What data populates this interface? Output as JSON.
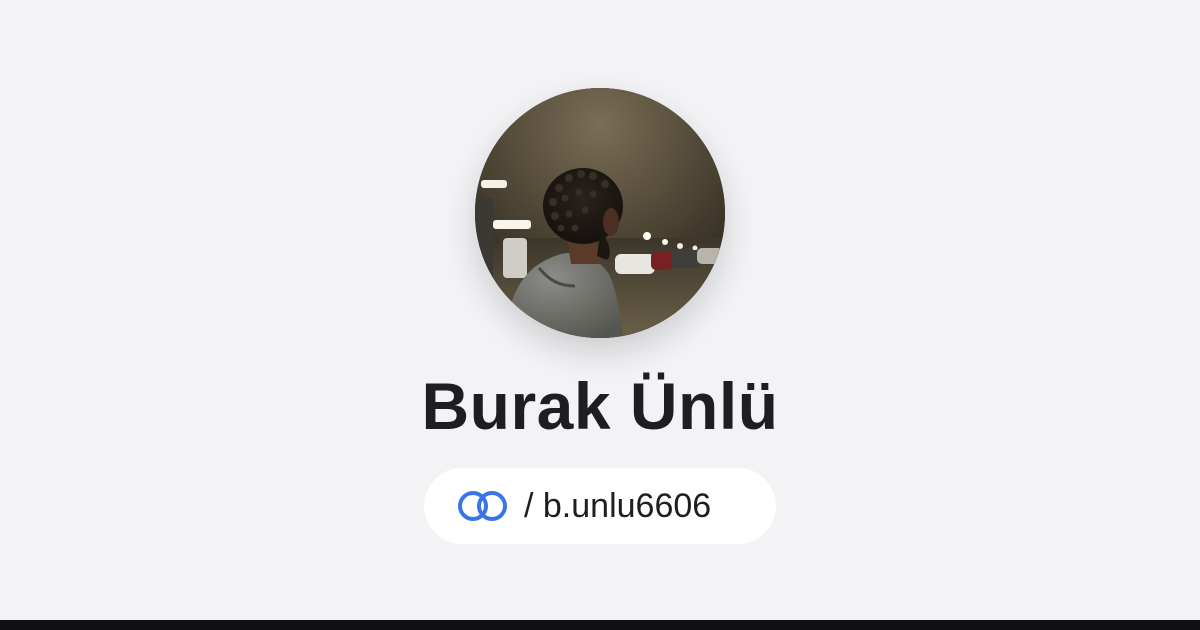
{
  "profile": {
    "name": "Burak Ünlü",
    "handle": "/ b.unlu6606",
    "avatar_icon": "profile-photo"
  },
  "brand": {
    "icon": "linked-rings-icon",
    "accent": "#3b74e8"
  },
  "colors": {
    "background": "#f3f3f6",
    "text": "#1e1e22",
    "pill": "#ffffff",
    "bottom_bar": "#111113"
  }
}
